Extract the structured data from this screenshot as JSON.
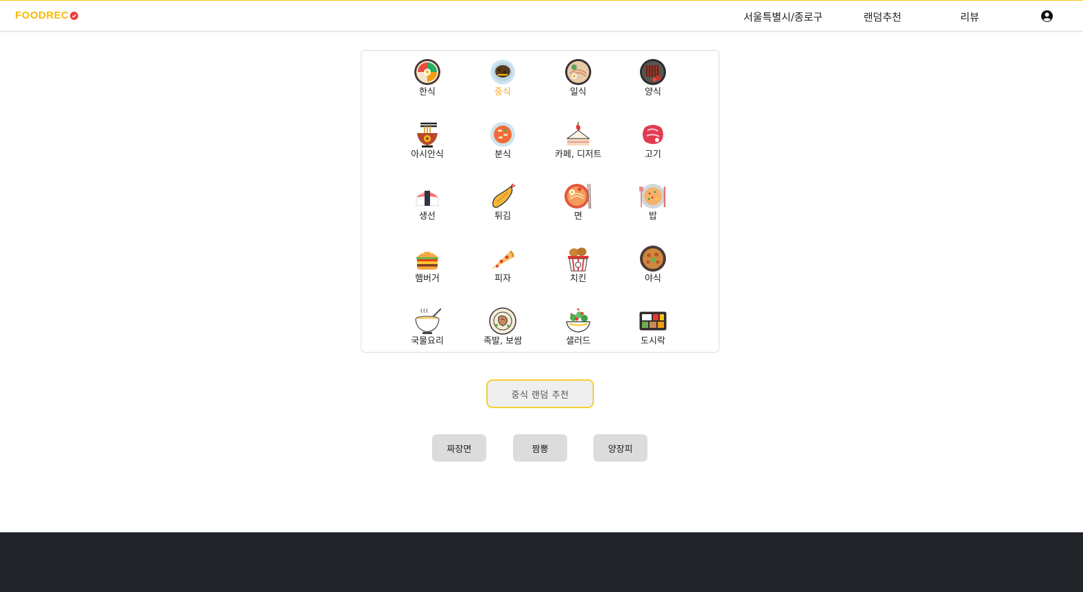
{
  "header": {
    "logo_text": "FOODREC",
    "location": "서울특별시/종로구",
    "nav_random": "랜덤추천",
    "nav_review": "리뷰",
    "accent_color": "#f5b800"
  },
  "categories": [
    {
      "label": "한식",
      "icon": "bibimbap-icon"
    },
    {
      "label": "중식",
      "icon": "jajangmyeon-icon",
      "selected": true
    },
    {
      "label": "일식",
      "icon": "ramen-icon"
    },
    {
      "label": "양식",
      "icon": "steak-icon"
    },
    {
      "label": "아시안식",
      "icon": "noodle-bowl-icon"
    },
    {
      "label": "분식",
      "icon": "tteokbokki-icon"
    },
    {
      "label": "카페, 디저트",
      "icon": "cake-icon"
    },
    {
      "label": "고기",
      "icon": "meat-icon"
    },
    {
      "label": "생선",
      "icon": "sushi-icon"
    },
    {
      "label": "튀김",
      "icon": "fried-shrimp-icon"
    },
    {
      "label": "면",
      "icon": "noodle-icon"
    },
    {
      "label": "밥",
      "icon": "fried-rice-icon"
    },
    {
      "label": "햄버거",
      "icon": "hamburger-icon"
    },
    {
      "label": "피자",
      "icon": "pizza-icon"
    },
    {
      "label": "치킨",
      "icon": "chicken-icon"
    },
    {
      "label": "야식",
      "icon": "late-night-food-icon"
    },
    {
      "label": "국물요리",
      "icon": "soup-icon"
    },
    {
      "label": "족발, 보쌈",
      "icon": "jokbal-icon"
    },
    {
      "label": "샐러드",
      "icon": "salad-icon"
    },
    {
      "label": "도시락",
      "icon": "lunchbox-icon"
    }
  ],
  "random_button": "중식 랜덤 추천",
  "results": [
    "짜장면",
    "짬뽕",
    "양장피"
  ]
}
